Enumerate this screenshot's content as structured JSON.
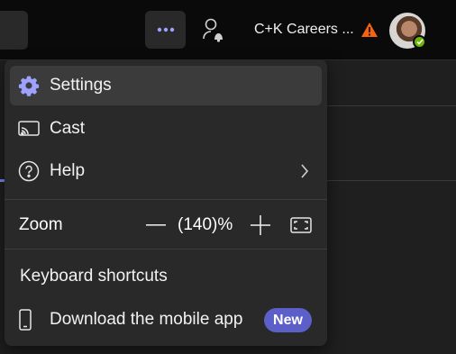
{
  "topbar": {
    "org_name": "C+K Careers ...",
    "more_icon": "more-horizontal-icon",
    "person_icon": "person-alert-icon",
    "warning_icon": "warning-icon",
    "status": "available",
    "accent_color": "#7f85f5"
  },
  "menu": {
    "settings_label": "Settings",
    "cast_label": "Cast",
    "help_label": "Help",
    "zoom_label": "Zoom",
    "zoom_value": "(140)%",
    "keyboard_label": "Keyboard shortcuts",
    "download_label": "Download the mobile app",
    "new_badge": "New",
    "badge_color": "#5b5fc7"
  }
}
